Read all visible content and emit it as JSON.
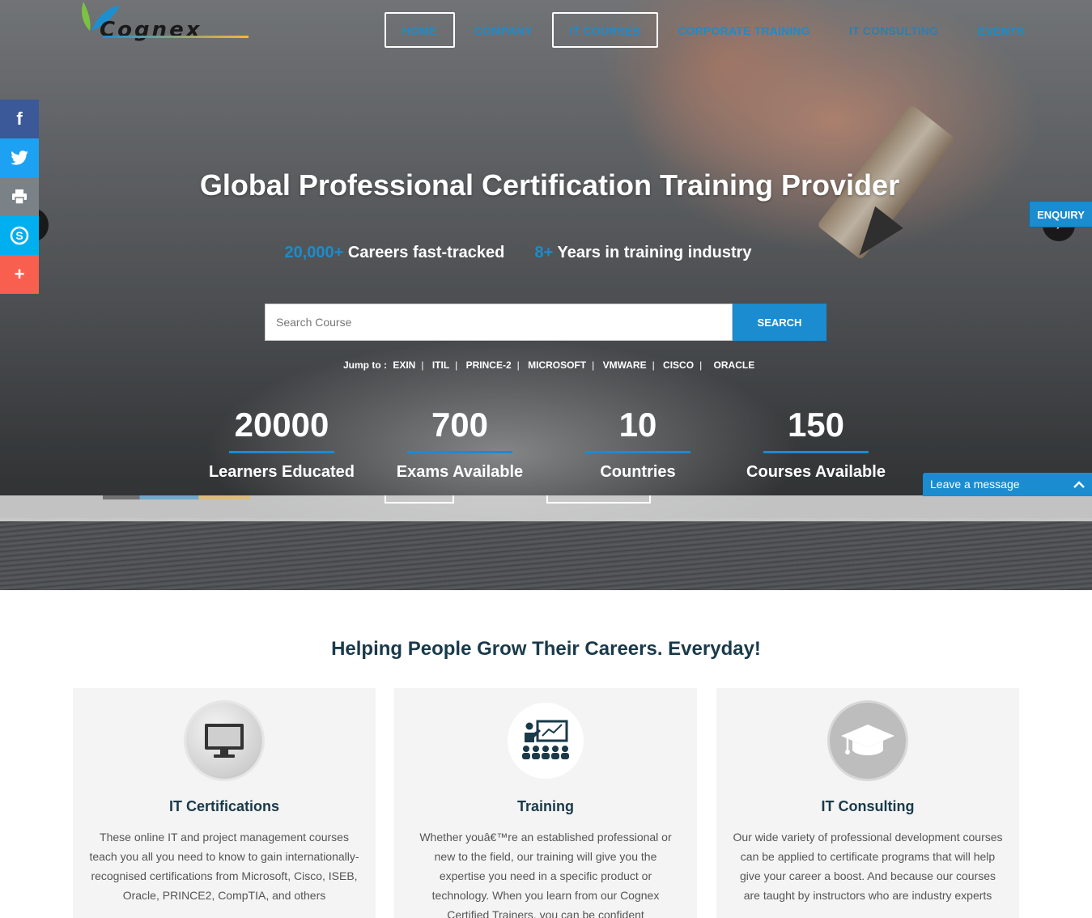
{
  "brand": {
    "logo_text": "Cognex"
  },
  "nav": {
    "items": [
      {
        "label": "HOME"
      },
      {
        "label": "COMPANY"
      },
      {
        "label": "IT COURSES"
      },
      {
        "label": "CORPORATE TRAINING"
      },
      {
        "label": "IT CONSULTING"
      },
      {
        "label": "EVENTS"
      }
    ]
  },
  "social": {
    "icons": [
      "facebook-icon",
      "twitter-icon",
      "print-icon",
      "skype-icon",
      "plus-icon"
    ]
  },
  "enquiry": {
    "label": "ENQUIRY"
  },
  "hero": {
    "title": "Global Professional Certification Training Provider",
    "stat1_highlight": "20,000+",
    "stat1_text": "Careers fast-tracked",
    "stat2_highlight": "8+",
    "stat2_text": "Years in training industry"
  },
  "search": {
    "placeholder": "Search Course",
    "button_label": "SEARCH"
  },
  "jump": {
    "label": "Jump to :",
    "links": [
      "EXIN",
      "ITIL",
      "PRINCE-2",
      "MICROSOFT",
      "VMWARE",
      "CISCO",
      "ORACLE"
    ]
  },
  "counters": [
    {
      "value": "20000",
      "label": "Learners Educated"
    },
    {
      "value": "700",
      "label": "Exams Available"
    },
    {
      "value": "10",
      "label": "Countries"
    },
    {
      "value": "150",
      "label": "Courses Available"
    }
  ],
  "chat": {
    "label": "Leave a message"
  },
  "section": {
    "title": "Helping People Grow Their Careers. Everyday!",
    "cards": [
      {
        "icon": "monitor-icon",
        "title": "IT Certifications",
        "text": "These online IT and project management courses teach you all you need to know to gain internationally-recognised certifications from Microsoft, Cisco, ISEB, Oracle, PRINCE2, CompTIA, and others"
      },
      {
        "icon": "classroom-icon",
        "title": "Training",
        "text": "Whether youâ€™re an established professional or new to the field, our training will give you the expertise you need in a specific product or technology. When you learn from our Cognex Certified Trainers, you can be confident"
      },
      {
        "icon": "graduation-cap-icon",
        "title": "IT Consulting",
        "text": "Our wide variety of professional development courses can be applied to certificate programs that will help give your career a boost. And because our courses are taught by instructors who are industry experts"
      }
    ]
  },
  "colors": {
    "accent": "#1a8ccf",
    "heading": "#1a3a4a",
    "card_bg": "#f4f4f4"
  }
}
